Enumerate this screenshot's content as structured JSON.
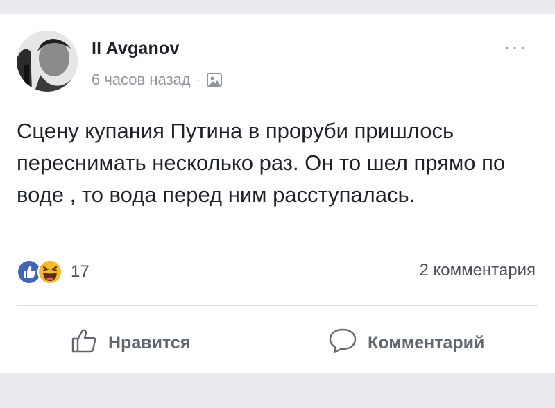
{
  "post": {
    "author": "Il Avganov",
    "time": "6 часов назад",
    "separator": "·",
    "more_label": "···",
    "text": "Сцену купания Путина в проруби пришлось переснимать несколько раз. Он то шел прямо по воде , то вода перед ним расступалась.",
    "reaction_count": "17",
    "comments_count": "2 комментария"
  },
  "actions": {
    "like_label": "Нравится",
    "comment_label": "Комментарий"
  },
  "colors": {
    "like_blue": "#4267b2",
    "haha_yellow": "#f7b928",
    "secondary_text": "#90949c"
  },
  "icons": [
    "avatar",
    "audience-photo-icon",
    "more-icon",
    "like-reaction-icon",
    "haha-reaction-icon",
    "thumbs-up-icon",
    "comment-bubble-icon"
  ]
}
